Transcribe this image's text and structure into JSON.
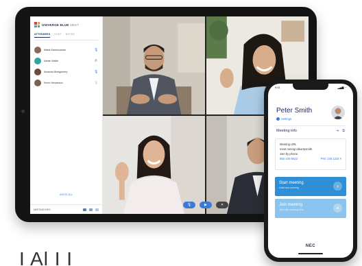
{
  "app": {
    "brand": "UNIVERGE BLUE",
    "brand_suffix": "MEET",
    "logo_colors": [
      "#e23a3a",
      "#f5a623",
      "#3aa0e2",
      "#4caf50"
    ]
  },
  "sidebar": {
    "tabs": [
      {
        "label": "ATTENDEES",
        "active": true
      },
      {
        "label": "CHAT",
        "active": false
      },
      {
        "label": "NOTES",
        "active": false
      }
    ],
    "attendees": [
      {
        "name": "Malek Kamruzaman",
        "avatar_color": "#8a6a55",
        "icon": "mic-icon",
        "icon_glyph": "🎙"
      },
      {
        "name": "Adrian Walsh",
        "avatar_color": "#2fa4a0",
        "icon": "phone-icon",
        "icon_glyph": "✆"
      },
      {
        "name": "Amanda Montgomery",
        "avatar_color": "#6e4a3c",
        "icon": "mic-icon",
        "icon_glyph": "🎙"
      },
      {
        "name": "Kevin Henderson",
        "avatar_color": "#7a6050",
        "icon": "mic-muted-icon",
        "icon_glyph": "🎙"
      }
    ],
    "invite_label": "INVITE ALL",
    "meeting_bar_label": "MEETING INFO"
  },
  "video": {
    "controls": [
      {
        "name": "mic-button",
        "glyph": "🎙",
        "color": "#3a7bd5"
      },
      {
        "name": "video-button",
        "glyph": "▶",
        "color": "#3a7bd5"
      },
      {
        "name": "end-call-button",
        "glyph": "✕",
        "color": "#444"
      }
    ]
  },
  "phone": {
    "time": "9:41",
    "signal": "▂▄▆ ◔",
    "user_name": "Peter Smith",
    "user_status": "Settings",
    "meeting_info_title": "Meeting info",
    "meeting_info_icons": [
      "➜",
      "⧉"
    ],
    "card": {
      "url_label": "Meeting URL",
      "url_value": "meet.mnergo.blue/psmith",
      "phone_label": "Join by phone",
      "phone_number": "555-100-5522",
      "pin": "PIN: 135 1234 #"
    },
    "start_button": {
      "title": "Start meeting",
      "subtitle": "Host new meeting"
    },
    "join_button": {
      "title": "Join meeting",
      "subtitle": "Join with meeting URL"
    },
    "brand": "NEC"
  },
  "footer_text": "I Al I I"
}
